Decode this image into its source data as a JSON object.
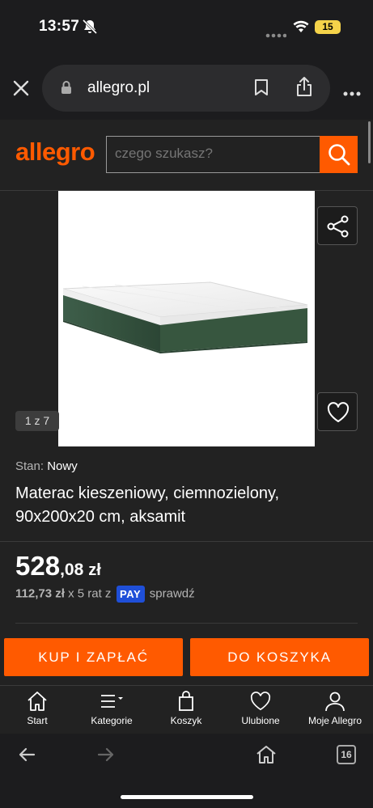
{
  "status_bar": {
    "time": "13:57",
    "battery": "15"
  },
  "browser": {
    "url": "allegro.pl",
    "tabs_count": "16"
  },
  "header": {
    "logo": "allegro",
    "search_placeholder": "czego szukasz?"
  },
  "gallery": {
    "counter": "1 z 7"
  },
  "product": {
    "condition_label": "Stan:",
    "condition_value": "Nowy",
    "title": "Materac kieszeniowy, ciemnozielony, 90x200x20 cm, aksamit",
    "price_int": "528",
    "price_dec": ",08",
    "currency": "zł",
    "installment_amount": "112,73 zł",
    "installment_text": "x 5 rat z",
    "pay_badge": "PAY",
    "installment_link": "sprawdź"
  },
  "actions": {
    "buy_label": "KUP I ZAPŁAĆ",
    "cart_label": "DO KOSZYKA"
  },
  "app_nav": {
    "items": [
      {
        "label": "Start",
        "icon": "home-icon"
      },
      {
        "label": "Kategorie",
        "icon": "menu-icon"
      },
      {
        "label": "Koszyk",
        "icon": "cart-icon"
      },
      {
        "label": "Ulubione",
        "icon": "heart-icon"
      },
      {
        "label": "Moje Allegro",
        "icon": "user-icon"
      }
    ]
  },
  "colors": {
    "brand": "#ff5a00",
    "pay_blue": "#1f4fd8",
    "background": "#222222"
  }
}
